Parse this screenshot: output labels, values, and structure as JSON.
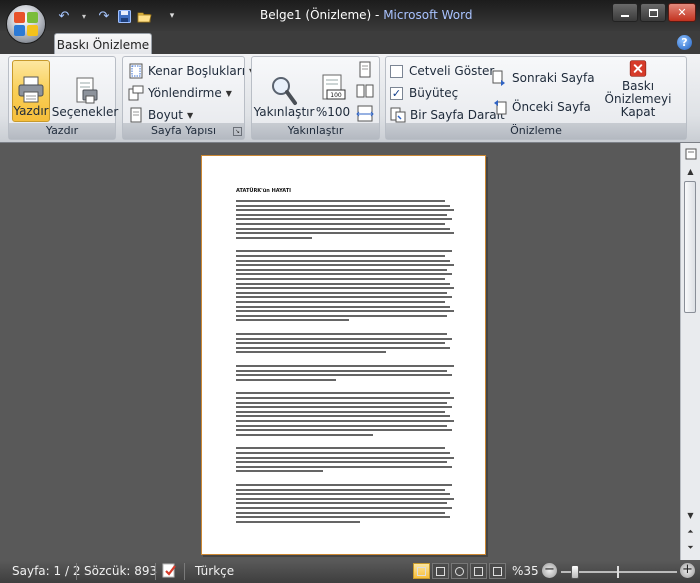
{
  "title": {
    "doc": "Belge1 (Önizleme)",
    "separator": " - ",
    "app": "Microsoft Word"
  },
  "tabs": [
    {
      "label": "Baskı Önizleme",
      "active": true
    }
  ],
  "ribbon": {
    "print_group": {
      "label": "Yazdır",
      "print": "Yazdır",
      "options": "Seçenekler"
    },
    "page_setup_group": {
      "label": "Sayfa Yapısı",
      "margins": "Kenar Boşlukları",
      "orientation": "Yönlendirme",
      "size": "Boyut"
    },
    "zoom_group": {
      "label": "Yakınlaştır",
      "zoom": "Yakınlaştır",
      "percent100": "%100"
    },
    "preview_group": {
      "label": "Önizleme",
      "show_ruler": "Cetveli Göster",
      "show_ruler_checked": false,
      "magnifier": "Büyüteç",
      "magnifier_checked": true,
      "shrink": "Bir Sayfa Daralt",
      "next_page": "Sonraki Sayfa",
      "prev_page": "Önceki Sayfa",
      "close_line1": "Baskı Önizlemeyi",
      "close_line2": "Kapat"
    }
  },
  "document": {
    "heading": "ATATÜRK'ün HAYATI",
    "paragraphs": [
      9,
      16,
      5,
      4,
      10,
      6,
      9
    ]
  },
  "status": {
    "page": "Sayfa: 1 / 2",
    "words": "Sözcük: 893",
    "language": "Türkçe",
    "zoom": "%35"
  },
  "colors": {
    "accent": "#f6be3a",
    "title_app": "#a9c3ff",
    "close_red": "#d63b2a"
  }
}
